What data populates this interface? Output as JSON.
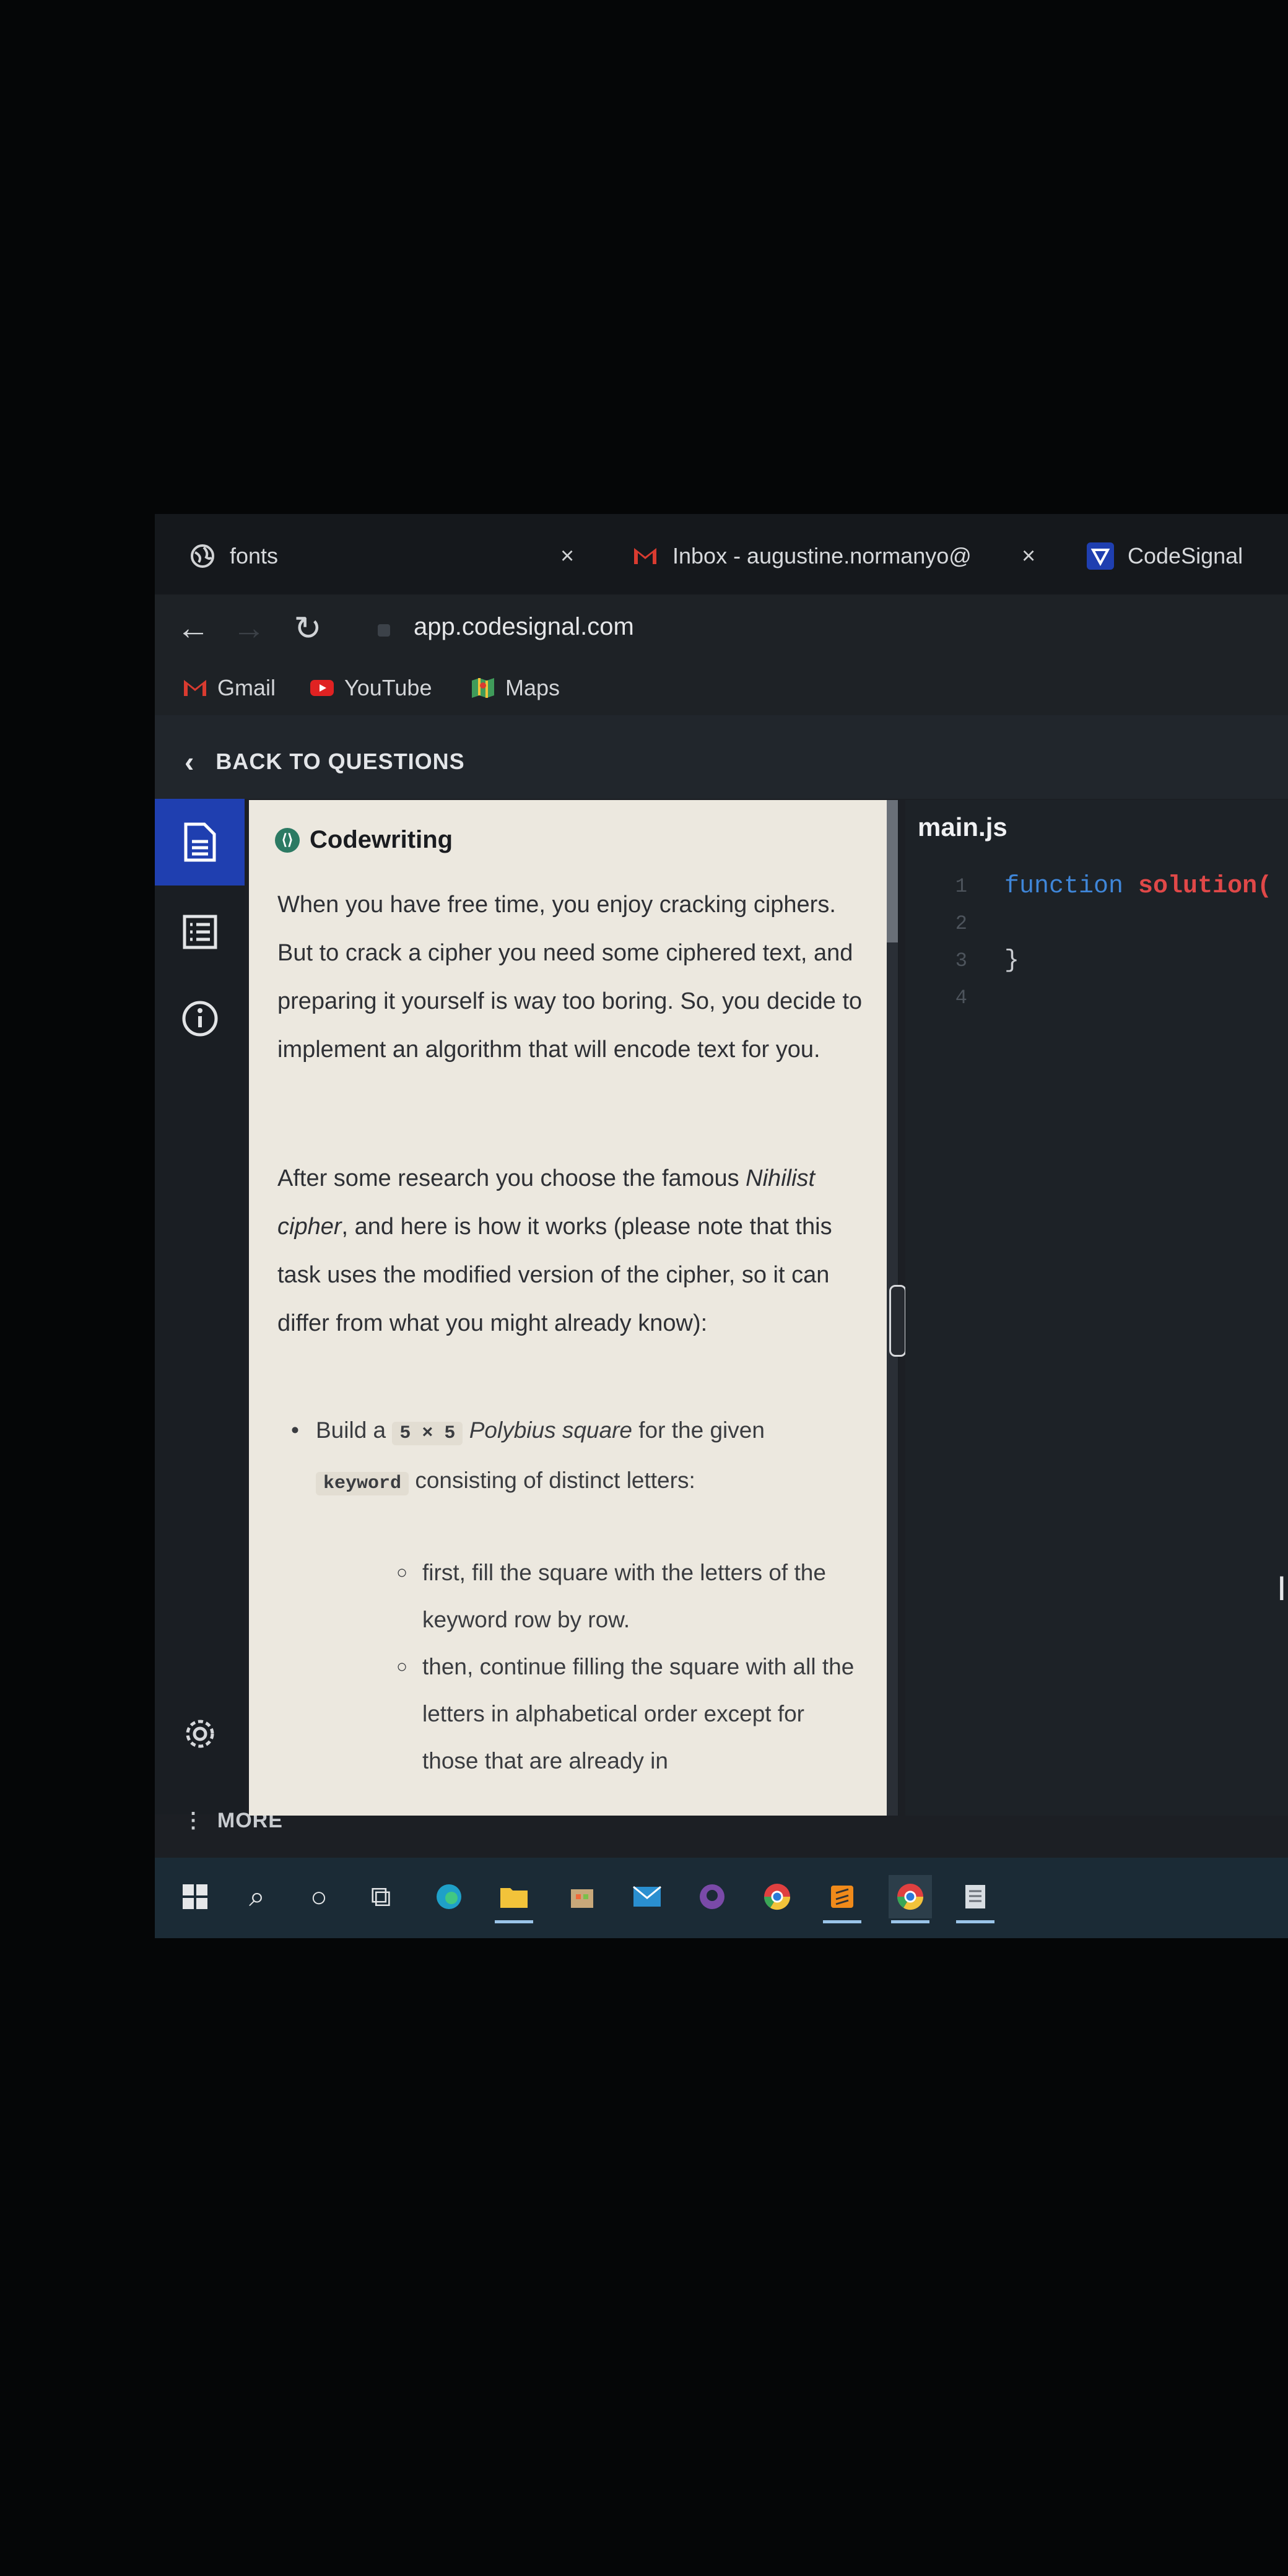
{
  "browser": {
    "tabs": [
      {
        "title": "fonts",
        "icon": "globe-icon",
        "closable": true
      },
      {
        "title": "Inbox - augustine.normanyo@",
        "icon": "gmail-icon",
        "closable": true
      },
      {
        "title": "CodeSignal",
        "icon": "codesignal-icon",
        "closable": false
      }
    ],
    "url": "app.codesignal.com",
    "bookmarks": [
      {
        "label": "Gmail",
        "icon": "gmail-icon"
      },
      {
        "label": "YouTube",
        "icon": "youtube-icon"
      },
      {
        "label": "Maps",
        "icon": "maps-icon"
      }
    ]
  },
  "app": {
    "back_label": "BACK TO QUESTIONS",
    "more_label": "MORE",
    "rail": [
      "description-icon",
      "list-icon",
      "info-icon",
      "settings-icon"
    ]
  },
  "description": {
    "heading": "Codewriting",
    "para1": "When you have free time, you enjoy cracking ciphers. But to crack a cipher you need some ciphered text, and preparing it yourself is way too boring. So, you decide to implement an algorithm that will encode text for you.",
    "para2_before": "After some research you choose the famous ",
    "para2_em": "Nihilist cipher",
    "para2_after": ", and here is how it works (please note that this task uses the modified version of the cipher, so it can differ from what you might already know):",
    "bullet_build": "Build a",
    "bullet_size": "5 × 5",
    "bullet_square": "Polybius square",
    "bullet_for": "for the given",
    "bullet_keyword": "keyword",
    "bullet_rest": "consisting of distinct letters:",
    "sub1": "first, fill the square with the letters of the keyword row by row.",
    "sub2": "then, continue filling the square with all the letters in alphabetical order except for those that are already in"
  },
  "editor": {
    "filename": "main.js",
    "lines": [
      "1",
      "2",
      "3",
      "4"
    ],
    "code_keyword": "function",
    "code_fn": "solution(",
    "code_close": "}"
  }
}
